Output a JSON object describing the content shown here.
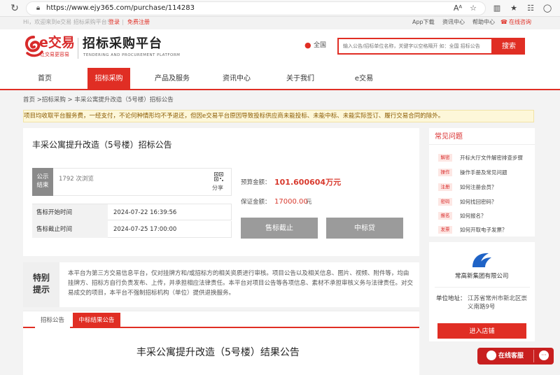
{
  "browser": {
    "url": "https://www.ejy365.com/purchase/114283",
    "reader_icon": "Aᴬ"
  },
  "topbar": {
    "greeting": "Hi，欢迎来到e交易 招标采购平台！",
    "login": "登录",
    "divider": "|",
    "register": "免费注册",
    "app_download": "App下载",
    "news_center": "资讯中心",
    "help_center": "帮助中心",
    "online_consult": "在线咨询"
  },
  "header": {
    "logo_text": "e交易",
    "logo_slogan": "让交易更容易",
    "platform_title": "招标采购平台",
    "platform_en": "TENDERING AND PROCUREMENT PLATFORM",
    "location": "全国",
    "search_placeholder": "输入公告/招标单位名称，关键字以空格隔开 如：全国 招标公告",
    "search_button": "搜索"
  },
  "nav": {
    "items": [
      {
        "label": "首页"
      },
      {
        "label": "招标采购"
      },
      {
        "label": "产品及服务"
      },
      {
        "label": "资讯中心"
      },
      {
        "label": "关于我们"
      },
      {
        "label": "e交易"
      }
    ]
  },
  "breadcrumb": "首页 >招标采购 > 丰采公寓提升改造（5号楼）招标公告",
  "notice": "项目均收取平台服务费，一经支付，不论何种情形均不予退还，但因e交易平台原因导致投标供应商未能投标、未能中标、未能实际签订、履行交易合同的除外。",
  "announcement": {
    "title": "丰采公寓提升改造（5号楼）招标公告",
    "status_line1": "公示",
    "status_line2": "结束",
    "views": "1792 次浏览",
    "share": "分享",
    "sale_start_label": "售标开始时间",
    "sale_start_value": "2024-07-22 16:39:56",
    "sale_end_label": "售标截止时间",
    "sale_end_value": "2024-07-25 17:00:00",
    "budget_label": "预算金额：",
    "budget_value": "101.600604万元",
    "deposit_label": "保证金额：",
    "deposit_value": "17000.00",
    "deposit_unit": "元",
    "closed_button": "售标截止",
    "loan_button": "中标贷"
  },
  "tip": {
    "title": "特别提示",
    "text": "本平台为第三方交易信息平台，仅对挂牌方和/或招标方的相关资质进行审核。项目公告以及相关信息、图片、视频、附件等，均由挂牌方、招标方自行负责发布、上传，并承担相应法律责任。本平台对项目公告等各项信息、素材不承担审核义务与法律责任。对交易成交的项目，本平台不强制招标机构（单位）提供退换服务。"
  },
  "tabs": [
    {
      "label": "招标公告"
    },
    {
      "label": "中标结果公告"
    }
  ],
  "result_title": "丰采公寓提升改造（5号楼）结果公告",
  "faq": {
    "title": "常见问题",
    "items": [
      {
        "tag": "解密",
        "text": "开标大厅文件解密排查步骤"
      },
      {
        "tag": "操作",
        "text": "操作手册及常见问题"
      },
      {
        "tag": "注册",
        "text": "如何注册会员？"
      },
      {
        "tag": "密码",
        "text": "如何找回密码？"
      },
      {
        "tag": "报名",
        "text": "如何报名？"
      },
      {
        "tag": "发票",
        "text": "如何开取电子发票？"
      }
    ]
  },
  "company": {
    "name": "常高新集团有限公司",
    "address_label": "单位地址：",
    "address": "江苏省常州市新北区崇义南路9号",
    "button": "进入店铺"
  },
  "service": {
    "label": "在线客服",
    "chat": "···"
  },
  "colors": {
    "brand_red": "#e02e24",
    "price_red": "#d83a2e",
    "notice_bg": "#fdf7d9"
  }
}
